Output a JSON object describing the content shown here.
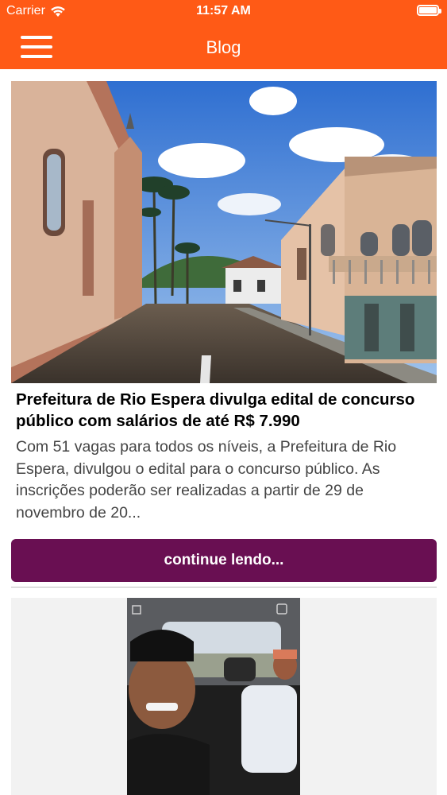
{
  "status_bar": {
    "carrier": "Carrier",
    "time": "11:57 AM"
  },
  "nav": {
    "title": "Blog"
  },
  "posts": [
    {
      "title": "Prefeitura de Rio Espera divulga edital de concurso público com salários de até R$ 7.990",
      "excerpt": "Com 51 vagas para todos os níveis, a Prefeitura de Rio Espera, divulgou o edital para o concurso público. As inscrições poderão ser realizadas a partir de 29 de novembro de 20...",
      "button_label": "continue lendo..."
    }
  ],
  "colors": {
    "header": "#ff5a16",
    "button": "#690f52"
  }
}
